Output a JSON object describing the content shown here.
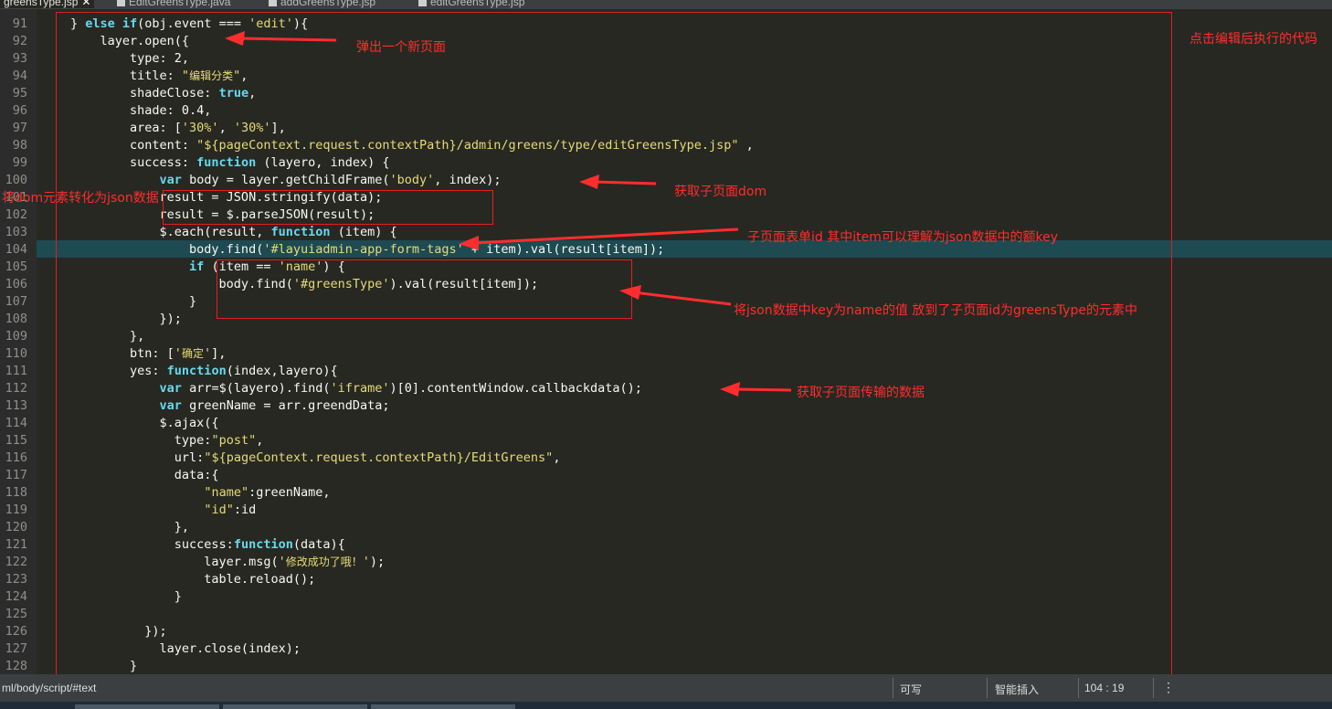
{
  "tabs": [
    {
      "label": "greensType.jsp",
      "active": true
    },
    {
      "label": "EditGreensType.java",
      "active": false
    },
    {
      "label": "addGreensType.jsp",
      "active": false
    },
    {
      "label": "editGreensType.jsp",
      "active": false
    }
  ],
  "code": {
    "line_numbers": [
      "91",
      "92",
      "93",
      "94",
      "95",
      "96",
      "97",
      "98",
      "99",
      "100",
      "101",
      "102",
      "103",
      "104",
      "105",
      "106",
      "107",
      "108",
      "109",
      "110",
      "111",
      "112",
      "113",
      "114",
      "115",
      "116",
      "117",
      "118",
      "119",
      "120",
      "121",
      "122",
      "123",
      "124",
      "125",
      "126",
      "127",
      "128"
    ],
    "highlighted_line": "104"
  },
  "annotations": {
    "popup_page": "弹出一个新页面",
    "after_edit_click": "点击编辑后执行的代码",
    "get_child_dom": "获取子页面dom",
    "dom_to_json": "将dom元素转化为json数据",
    "child_form_id": "子页面表单id  其中item可以理解为json数据中的额key",
    "name_value_to_child": "将json数据中key为name的值  放到了子页面id为greensType的元素中",
    "get_child_data": "获取子页面传输的数据"
  },
  "statusbar": {
    "path": "ml/body/script/#text",
    "writable": "可写",
    "insert_mode": "智能插入",
    "position": "104 : 19",
    "menu_icon": "vertical-dots-icon"
  },
  "colors": {
    "background": "#272822",
    "keyword": "#66d9ef",
    "string": "#e6db74",
    "annotation": "#ff2d2d",
    "current_line": "#1e4a52"
  }
}
